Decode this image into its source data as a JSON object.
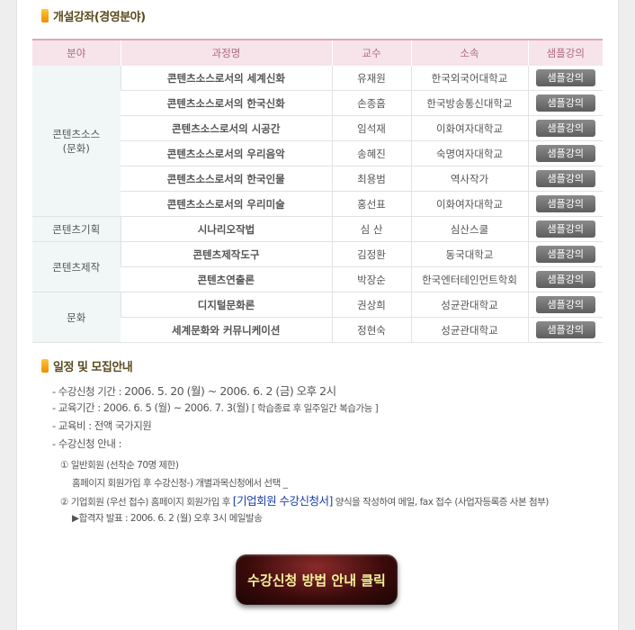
{
  "section_courses": {
    "title": "개설강좌(경영분야)"
  },
  "table": {
    "headers": [
      "분야",
      "과정명",
      "교수",
      "소속",
      "샘플강의"
    ],
    "sample_label": "샘플강의",
    "categories": [
      {
        "name": "콘텐츠소스\n(문화)",
        "rows": [
          {
            "course": "콘텐츠소스로서의 세계신화",
            "professor": "유재원",
            "affiliation": "한국외국어대학교"
          },
          {
            "course": "콘텐츠소스로서의 한국신화",
            "professor": "손종흠",
            "affiliation": "한국방송통신대학교"
          },
          {
            "course": "콘텐츠소스로서의 시공간",
            "professor": "임석재",
            "affiliation": "이화여자대학교"
          },
          {
            "course": "콘텐츠소스로서의 우리음악",
            "professor": "송혜진",
            "affiliation": "숙명여자대학교"
          },
          {
            "course": "콘텐츠소스로서의 한국인물",
            "professor": "최용범",
            "affiliation": "역사작가"
          },
          {
            "course": "콘텐츠소스로서의 우리미술",
            "professor": "홍선표",
            "affiliation": "이화여자대학교"
          }
        ]
      },
      {
        "name": "콘텐츠기획",
        "rows": [
          {
            "course": "시나리오작법",
            "professor": "심 산",
            "affiliation": "심산스쿨"
          }
        ]
      },
      {
        "name": "콘텐츠제작",
        "rows": [
          {
            "course": "콘텐츠제작도구",
            "professor": "김정환",
            "affiliation": "동국대학교"
          },
          {
            "course": "콘텐츠연출론",
            "professor": "박장순",
            "affiliation": "한국엔터테인먼트학회"
          }
        ]
      },
      {
        "name": "문화",
        "rows": [
          {
            "course": "디지털문화론",
            "professor": "권상희",
            "affiliation": "성균관대학교"
          },
          {
            "course": "세계문화와 커뮤니케이션",
            "professor": "정현숙",
            "affiliation": "성균관대학교"
          }
        ]
      }
    ]
  },
  "section_schedule": {
    "title": "일정 및 모집안내",
    "reg_period_label": "- 수강신청 기간 :",
    "reg_period_value": "2006. 5. 20 (월) ~ 2006. 6. 2 (금)  오후 2시",
    "edu_period_label": "- 교육기간 : 2006. 6. 5 (월) ~ 2006. 7. 3(월)",
    "edu_period_note": "[ 학습종료 후 일주일간 복습가능 ]",
    "fee": "- 교육비 : 전액 국가지원",
    "reg_guide": "- 수강신청 안내 :",
    "general_member_title": "① 일반회원 (선착순 70명 제한)",
    "general_member_desc": "홈페이지 회원가입 후 수강신청-) 개별과목신청에서 선택  _",
    "corp_member_prefix": "② 기업회원 (우선 접수) 홈페이지 회원가입 후",
    "corp_member_link": "[기업회원 수강신청서]",
    "corp_member_suffix": "양식을 작성하여 메일, fax 접수 (사업자등록증 사본 첨부)",
    "result_notice": "▶합격자 발표 : 2006. 6. 2 (월) 오후 3시 메일발송"
  },
  "cta_label": "수강신청 방법 안내 클릭"
}
